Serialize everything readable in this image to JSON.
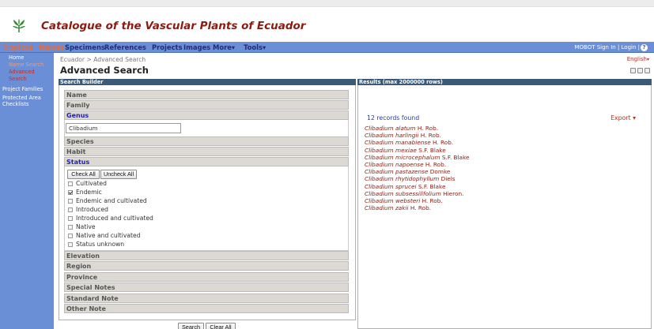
{
  "header": {
    "title": "Catalogue of the Vascular Plants of Ecuador",
    "logo_icon": "plant-logo-icon",
    "title_color": "#8b1a10"
  },
  "nav": {
    "items": [
      "Tropicos",
      "Names",
      "Specimens",
      "References",
      "Projects",
      "Images",
      "More",
      "Tools"
    ],
    "right_text": "MOBOT Sign In | Login |",
    "help_glyph": "?",
    "bar_color": "#6b8fd6",
    "highlight_color": "#e06b42"
  },
  "sidebar": {
    "items": [
      "Home",
      "Name Search",
      "Advanced",
      "Search",
      "Project Families",
      "Protected Area",
      "Checklists"
    ]
  },
  "breadcrumb": "Ecuador > Advanced Search",
  "page_title": "Advanced Search",
  "language": "English",
  "builder": {
    "title": "Search Builder",
    "sections": {
      "name": "Name",
      "family": "Family",
      "genus": "Genus",
      "species": "Species",
      "habit": "Habit",
      "status": "Status",
      "elevation": "Elevation",
      "region": "Region",
      "province": "Province",
      "special_notes": "Special Notes",
      "standard_note": "Standard Note",
      "other_note": "Other Note"
    },
    "genus_value": "Clibadium",
    "check_all": "Check All",
    "uncheck_all": "Uncheck All",
    "status_options": [
      {
        "label": "Cultivated",
        "checked": false
      },
      {
        "label": "Endemic",
        "checked": true
      },
      {
        "label": "Endemic and cultivated",
        "checked": false
      },
      {
        "label": "Introduced",
        "checked": false
      },
      {
        "label": "Introduced and cultivated",
        "checked": false
      },
      {
        "label": "Native",
        "checked": false
      },
      {
        "label": "Native and cultivated",
        "checked": false
      },
      {
        "label": "Status unknown",
        "checked": false
      }
    ],
    "search_button": "Search",
    "clear_button": "Clear All"
  },
  "results": {
    "title": "Results (max 2000000 rows)",
    "count_text": "12 records found",
    "export_label": "Export",
    "items": [
      {
        "name": "Clibadium alatum",
        "author": "H. Rob."
      },
      {
        "name": "Clibadium harlingii",
        "author": "H. Rob."
      },
      {
        "name": "Clibadium manabiense",
        "author": "H. Rob."
      },
      {
        "name": "Clibadium mexiae",
        "author": "S.F. Blake"
      },
      {
        "name": "Clibadium microcephalum",
        "author": "S.F. Blake"
      },
      {
        "name": "Clibadium napoense",
        "author": "H. Rob."
      },
      {
        "name": "Clibadium pastazense",
        "author": "Domke"
      },
      {
        "name": "Clibadium rhytidophyllum",
        "author": "Diels"
      },
      {
        "name": "Clibadium sprucei",
        "author": "S.F. Blake"
      },
      {
        "name": "Clibadium subsessilifolium",
        "author": "Hieron."
      },
      {
        "name": "Clibadium websteri",
        "author": "H. Rob."
      },
      {
        "name": "Clibadium zakii",
        "author": "H. Rob."
      }
    ]
  }
}
